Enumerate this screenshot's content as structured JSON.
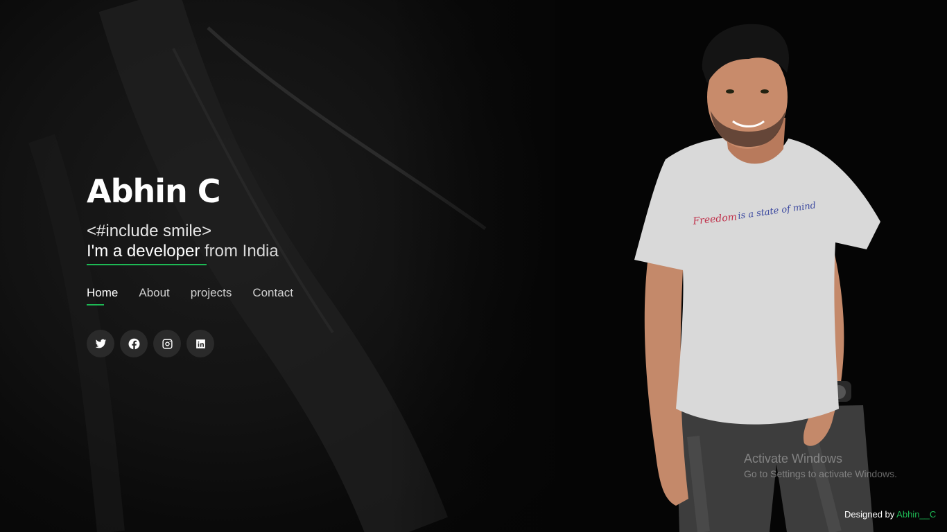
{
  "hero": {
    "name": "Abhin C",
    "tagline": "<#include smile>",
    "intro_strong": "I'm a developer",
    "intro_soft": " from India"
  },
  "nav": {
    "items": [
      {
        "label": "Home",
        "active": true
      },
      {
        "label": "About",
        "active": false
      },
      {
        "label": "projects",
        "active": false
      },
      {
        "label": "Contact",
        "active": false
      }
    ]
  },
  "social": [
    "twitter-icon",
    "facebook-icon",
    "instagram-icon",
    "linkedin-icon"
  ],
  "shirt_text": {
    "a": "Freedom",
    "b": "is a state of mind"
  },
  "watermark": {
    "title": "Activate Windows",
    "subtitle": "Go to Settings to activate Windows."
  },
  "footer": {
    "designed_by": "Designed by ",
    "author": "Abhin__C"
  },
  "colors": {
    "accent": "#1db954",
    "background": "#050505",
    "social_bg": "#2a2a2a"
  }
}
